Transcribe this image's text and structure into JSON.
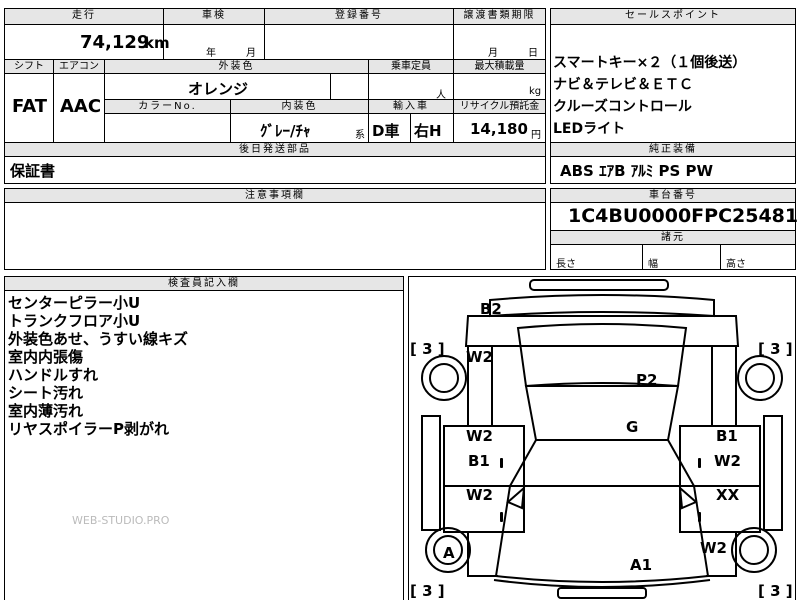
{
  "top_header": {
    "mileage_label": "走行",
    "inspection_label": "車検",
    "registration_label": "登録番号",
    "transfer_deadline_label": "譲渡書類期限",
    "sales_point_label": "セールスポイント"
  },
  "mileage": {
    "value": "74,129",
    "unit": "km"
  },
  "inspection": {
    "year_unit": "年",
    "month_unit": "月"
  },
  "transfer": {
    "month_unit": "月",
    "day_unit": "日"
  },
  "row2": {
    "shift_label": "シフト",
    "aircon_label": "エアコン",
    "exterior_color_label": "外装色",
    "capacity_label": "乗車定員",
    "max_load_label": "最大積載量",
    "shift": "FAT",
    "aircon": "AAC",
    "exterior_color": "オレンジ",
    "capacity_unit": "人",
    "load_unit": "kg",
    "color_no_label": "カラーNo.",
    "interior_label": "内装色",
    "import_label": "輸入車",
    "recycle_label": "リサイクル預託金",
    "interior_color": "ｸﾞﾚｰ/ﾁｬ",
    "interior_suffix": "系",
    "import_type": "D車",
    "steering": "右H",
    "recycle_value": "14,180",
    "recycle_unit": "円"
  },
  "sales_points": [
    "スマートキー×２（１個後送）",
    "ナビ＆テレビ＆ＥＴＣ",
    "クルーズコントロール",
    "LEDライト"
  ],
  "later_parts": {
    "label": "後日発送部品",
    "value": "保証書"
  },
  "standard_equipment": {
    "label": "純正装備",
    "value": "ABS ｴｱB ｱﾙﾐ PS PW"
  },
  "caution": {
    "label": "注意事項欄"
  },
  "chassis": {
    "label": "車台番号",
    "value": "1C4BU0000FPC25481"
  },
  "dimensions": {
    "label": "諸元",
    "length": "長さ",
    "width": "幅",
    "height": "高さ"
  },
  "inspector": {
    "label": "検査員記入欄",
    "notes": [
      "センターピラー小U",
      "トランクフロア小U",
      "外装色あせ、うすい線キズ",
      "室内内張傷",
      "ハンドルすれ",
      "シート汚れ",
      "室内薄汚れ",
      "リヤスポイラーP剥がれ"
    ],
    "watermark": "WEB-STUDIO.PRO"
  },
  "diagram": {
    "tires": {
      "rear_left": "3",
      "rear_right": "3",
      "front_left": "3",
      "front_right": "3"
    },
    "marks": {
      "rear_bumper": "B2",
      "rear_left_panel": "W2",
      "roof": "P2",
      "left_rear_door_a": "W2",
      "left_rear_door_b": "B1",
      "left_front_door": "W2",
      "floor": "G",
      "right_rear_door_a": "B1",
      "right_rear_door_b": "W2",
      "right_front_door": "XX",
      "front_left_wheel": "A",
      "hood": "A1",
      "front_right_fender": "W2"
    }
  }
}
